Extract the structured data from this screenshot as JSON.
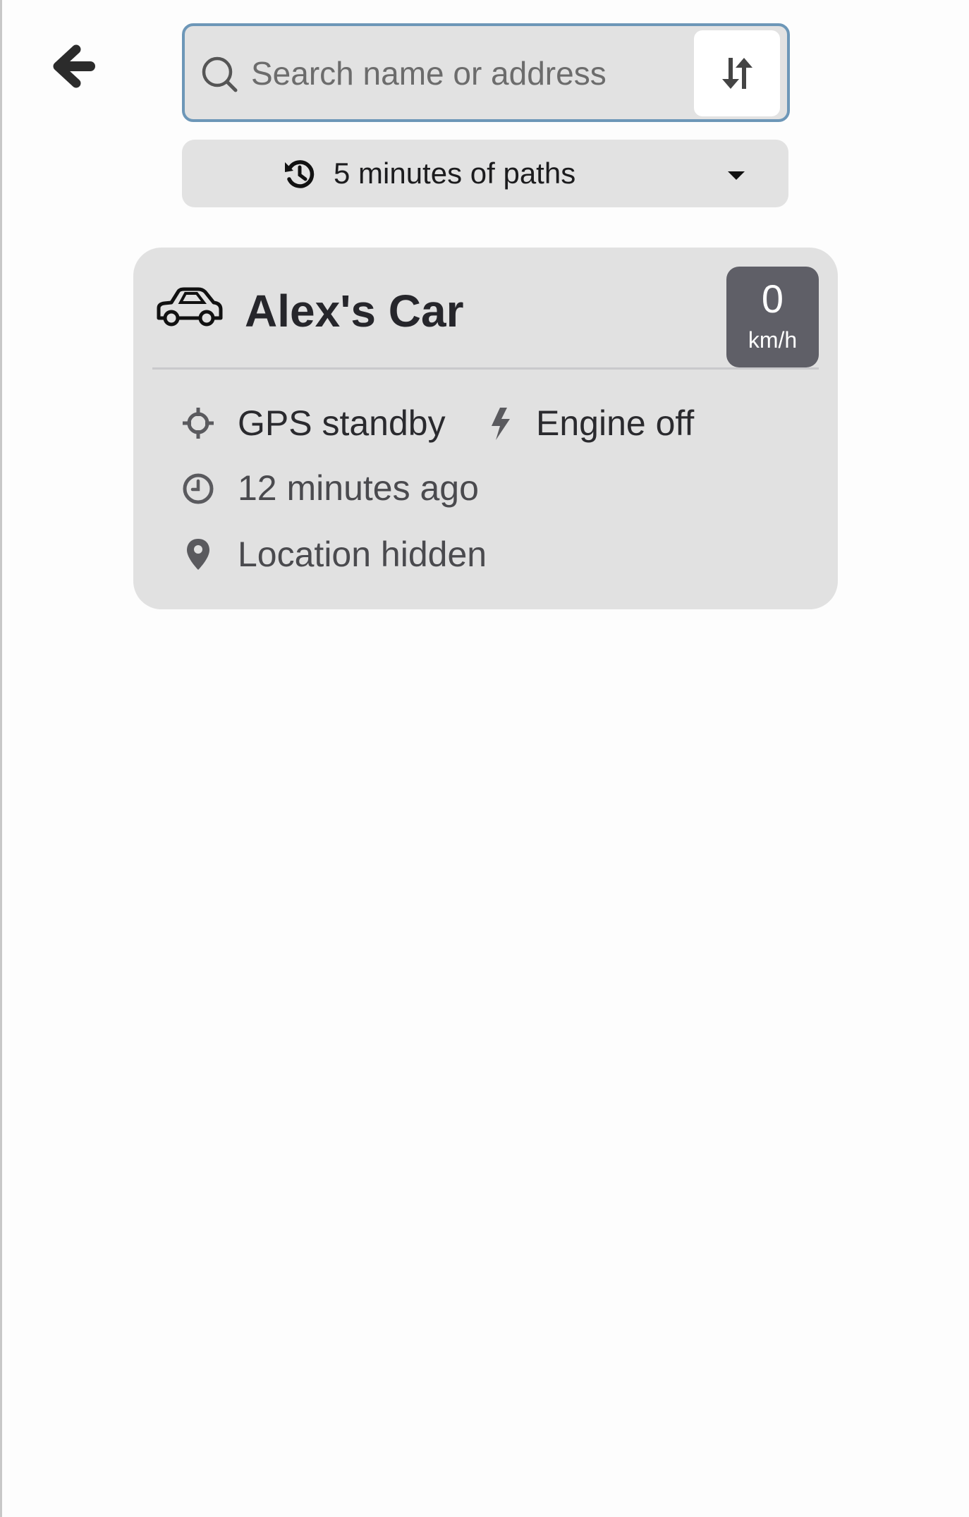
{
  "navigation": {
    "back_icon": "arrow-left-icon"
  },
  "search": {
    "placeholder": "Search name or address",
    "value": "",
    "search_icon": "search-icon",
    "sort_icon": "sort-icon"
  },
  "history_filter": {
    "label": "5 minutes of paths",
    "icon": "history-icon",
    "dropdown_icon": "caret-down-icon"
  },
  "vehicle": {
    "icon": "car-icon",
    "name": "Alex's Car",
    "speed": {
      "value": "0",
      "unit": "km/h"
    },
    "gps_status": "GPS standby",
    "engine_status": "Engine off",
    "last_update": "12 minutes ago",
    "location": "Location hidden"
  },
  "colors": {
    "search_border": "#6d97b8",
    "panel_background": "#e1e1e1",
    "speed_badge": "#5f5f67",
    "page_background": "#fdfdfd"
  }
}
